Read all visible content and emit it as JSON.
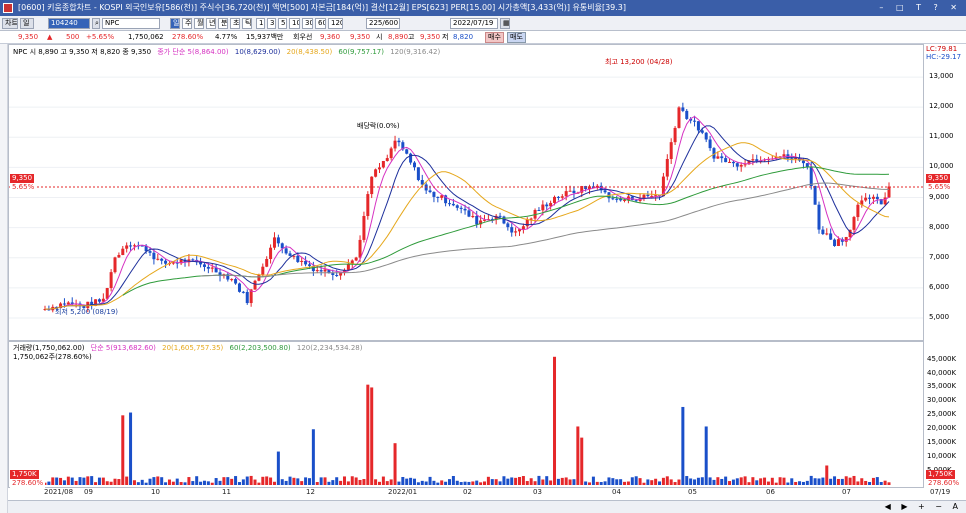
{
  "window": {
    "title": "[0600] 키움종합차트 - KOSPI 외국인보유[586(천)] 주식수[36,720(천)] 액면[500] 자본금[184(억)] 결산[12월] EPS[623] PER[15.00] 시가총액[3,433(억)] 유통비율[39.3]",
    "controls": "– □ T ? ✕"
  },
  "toolbar": {
    "period_buttons": [
      "주",
      "월",
      "년",
      "분",
      "초",
      "틱"
    ],
    "minute_buttons": [
      "1",
      "3",
      "5",
      "10",
      "30",
      "60",
      "120"
    ],
    "stock_code": "104240",
    "stock_name": "NPC",
    "range": "225/600",
    "date": "2022/07/19",
    "labels": [
      "차트",
      "일"
    ]
  },
  "pricebar": {
    "price": "9,350",
    "change": "500",
    "change_pct": "+5.65%",
    "volume": "1,750,062",
    "volume_pct": "278.60%",
    "turnover": "4.77%",
    "amount": "15,937백만",
    "prefs": "회우선",
    "open_v": "9,360",
    "open_hi": "9,350",
    "hi_label": "시",
    "high": "8,890",
    "hi2_label": "고",
    "high2": "9,350",
    "lo_label": "저",
    "low": "8,820",
    "buy": "매수",
    "sell": "매도"
  },
  "price_pane": {
    "legend_main": "NPC 시 8,890 고 9,350 저 8,820 종 9,350",
    "legend_ma": [
      {
        "text": "종가 단순 5(8,864.00)",
        "color": "#d633c2"
      },
      {
        "text": "10(8,629.00)",
        "color": "#1d2f9b"
      },
      {
        "text": "20(8,438.50)",
        "color": "#e6a81d"
      },
      {
        "text": "60(9,757.17)",
        "color": "#2f9b3b"
      },
      {
        "text": "120(9,316.42)",
        "color": "#8a8a8a"
      }
    ],
    "y_ticks": [
      "13,000",
      "12,000",
      "11,000",
      "10,000",
      "9,000",
      "8,000",
      "7,000",
      "6,000",
      "5,000"
    ],
    "current_badge": "9,350",
    "current_pct": "5.65%",
    "lc": "LC:79.81",
    "hc": "HC:-29.17",
    "high_note": "최고 13,200 (04/28)",
    "low_note": "최저 5,200 (08/19)",
    "dividend_note": "배당락(0.0%)",
    "colors": {
      "up": "#e5272a",
      "down": "#1a4fc9"
    }
  },
  "volume_pane": {
    "legend": [
      {
        "text": "거래량(1,750,062.00)",
        "color": "#333"
      },
      {
        "text": "단순 5(913,682.60)",
        "color": "#d633c2"
      },
      {
        "text": "20(1,605,757.35)",
        "color": "#e6a81d"
      },
      {
        "text": "60(2,203,500.80)",
        "color": "#2f9b3b"
      },
      {
        "text": "120(2,234,534.28)",
        "color": "#8a8a8a"
      }
    ],
    "legend2": "1,750,062주(278.60%)",
    "y_ticks": [
      "45,000K",
      "40,000K",
      "35,000K",
      "30,000K",
      "25,000K",
      "20,000K",
      "15,000K",
      "10,000K",
      "5,000K"
    ],
    "current_badge": "1,750K",
    "current_pct": "278.60%"
  },
  "x_axis": {
    "labels": [
      "2021/08",
      "09",
      "10",
      "11",
      "12",
      "2022/01",
      "02",
      "03",
      "04",
      "05",
      "06",
      "07",
      "07/19"
    ]
  },
  "chart_data": {
    "type": "candlestick",
    "period": "2021/08 - 2022/07/19",
    "ohlc_approx": [
      {
        "date": "2021/08/19",
        "close": 5200,
        "note": "최저"
      },
      {
        "date": "2021/09",
        "close": 7400
      },
      {
        "date": "2021/10",
        "close": 7000
      },
      {
        "date": "2021/11",
        "close": 6500
      },
      {
        "date": "2021/12",
        "close": 10500
      },
      {
        "date": "2022/01",
        "close": 9000
      },
      {
        "date": "2022/02",
        "close": 8300
      },
      {
        "date": "2022/03",
        "close": 9300
      },
      {
        "date": "2022/04/28",
        "close": 12000,
        "note": "최고 13,200"
      },
      {
        "date": "2022/05",
        "close": 10200
      },
      {
        "date": "2022/06",
        "close": 9800
      },
      {
        "date": "2022/07/19",
        "open": 8890,
        "high": 9350,
        "low": 8820,
        "close": 9350
      }
    ],
    "ylim": [
      4600,
      13600
    ],
    "volume_ylim": [
      0,
      47000000
    ]
  }
}
